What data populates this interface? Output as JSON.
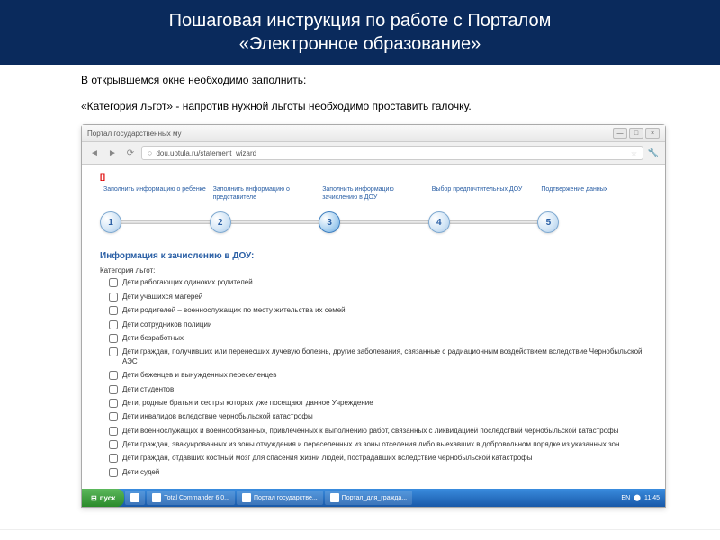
{
  "slide": {
    "title_line1": "Пошаговая инструкция по работе с Порталом",
    "title_line2": "«Электронное образование»"
  },
  "instructions": {
    "line1": "В открывшемся окне необходимо заполнить:",
    "line2": "«Категория льгот» - напротив нужной льготы необходимо проставить галочку."
  },
  "browser": {
    "tab_title": "Портал государственных му",
    "url": "dou.uotula.ru/statement_wizard",
    "red_marks": "[]"
  },
  "wizard": {
    "steps": [
      {
        "num": "1",
        "label": "Заполнить информацию о ребенке"
      },
      {
        "num": "2",
        "label": "Заполнить информацию о представителе"
      },
      {
        "num": "3",
        "label": "Заполнить информацию зачислению в ДОУ"
      },
      {
        "num": "4",
        "label": "Выбор предпочтительных ДОУ"
      },
      {
        "num": "5",
        "label": "Подтвержение данных"
      }
    ],
    "active_step": 3
  },
  "form": {
    "section_title": "Информация к зачислению в ДОУ:",
    "field_label": "Категория льгот:",
    "checkboxes": [
      "Дети работающих одиноких родителей",
      "Дети учащихся матерей",
      "Дети родителей – военнослужащих по месту жительства их семей",
      "Дети сотрудников полиции",
      "Дети безработных",
      "Дети граждан, получивших или перенесших лучевую болезнь, другие заболевания, связанные с радиационным воздействием вследствие Чернобыльской АЭС",
      "Дети беженцев и вынужденных переселенцев",
      "Дети студентов",
      "Дети, родные братья и сестры которых уже посещают данное Учреждение",
      "Дети инвалидов вследствие чернобыльской катастрофы",
      "Дети военнослужащих и военнообязанных, привлеченных к выполнению работ, связанных с ликвидацией последствий чернобыльской катастрофы",
      "Дети граждан, эвакуированных из зоны отчуждения и переселенных из зоны отселения либо выехавших в добровольном порядке из указанных зон",
      "Дети граждан, отдавших костный мозг для спасения жизни людей, пострадавших вследствие чернобыльской катастрофы",
      "Дети судей"
    ]
  },
  "taskbar": {
    "start": "пуск",
    "items": [
      "Total Commander 6.0...",
      "Портал государстве...",
      "Портал_для_гражда..."
    ],
    "lang": "EN",
    "time": "11:45"
  }
}
